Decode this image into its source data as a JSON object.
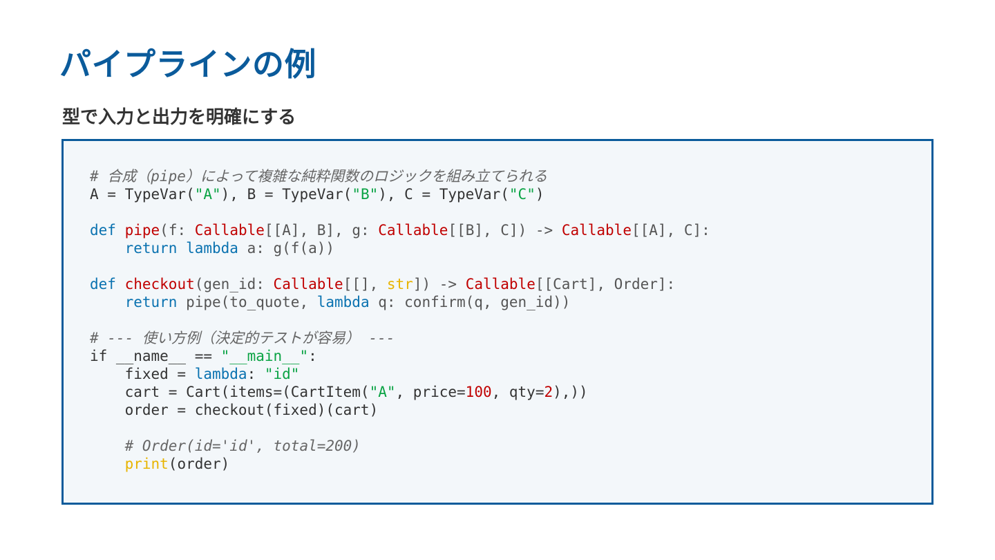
{
  "slide": {
    "title": "パイプラインの例",
    "subtitle": "型で入力と出力を明確にする"
  },
  "code": {
    "lines": [
      [
        {
          "t": "comment",
          "v": "# 合成（pipe）によって複雑な純粋関数のロジックを組み立てられる"
        }
      ],
      [
        {
          "t": "plain",
          "v": "A = TypeVar("
        },
        {
          "t": "str",
          "v": "\"A\""
        },
        {
          "t": "plain",
          "v": "), B = TypeVar("
        },
        {
          "t": "str",
          "v": "\"B\""
        },
        {
          "t": "plain",
          "v": "), C = TypeVar("
        },
        {
          "t": "str",
          "v": "\"C\""
        },
        {
          "t": "plain",
          "v": ")"
        }
      ],
      [],
      [
        {
          "t": "kw",
          "v": "def"
        },
        {
          "t": "plain",
          "v": " "
        },
        {
          "t": "fn",
          "v": "pipe"
        },
        {
          "t": "dim",
          "v": "(f: "
        },
        {
          "t": "type",
          "v": "Callable"
        },
        {
          "t": "dim",
          "v": "[[A], B], g: "
        },
        {
          "t": "type",
          "v": "Callable"
        },
        {
          "t": "dim",
          "v": "[[B], C]) -> "
        },
        {
          "t": "type",
          "v": "Callable"
        },
        {
          "t": "dim",
          "v": "[[A], C]:"
        }
      ],
      [
        {
          "t": "plain",
          "v": "    "
        },
        {
          "t": "kw",
          "v": "return"
        },
        {
          "t": "plain",
          "v": " "
        },
        {
          "t": "kw",
          "v": "lambda"
        },
        {
          "t": "dim",
          "v": " a: g(f(a))"
        }
      ],
      [],
      [
        {
          "t": "kw",
          "v": "def"
        },
        {
          "t": "plain",
          "v": " "
        },
        {
          "t": "fn",
          "v": "checkout"
        },
        {
          "t": "dim",
          "v": "(gen_id: "
        },
        {
          "t": "type",
          "v": "Callable"
        },
        {
          "t": "dim",
          "v": "[[], "
        },
        {
          "t": "builtin",
          "v": "str"
        },
        {
          "t": "dim",
          "v": "]) -> "
        },
        {
          "t": "type",
          "v": "Callable"
        },
        {
          "t": "dim",
          "v": "[[Cart], Order]:"
        }
      ],
      [
        {
          "t": "plain",
          "v": "    "
        },
        {
          "t": "kw",
          "v": "return"
        },
        {
          "t": "dim",
          "v": " pipe(to_quote, "
        },
        {
          "t": "kw",
          "v": "lambda"
        },
        {
          "t": "dim",
          "v": " q: confirm(q, gen_id))"
        }
      ],
      [],
      [
        {
          "t": "comment",
          "v": "# --- 使い方例（決定的テストが容易） ---"
        }
      ],
      [
        {
          "t": "plain",
          "v": "if __name__ == "
        },
        {
          "t": "str",
          "v": "\"__main__\""
        },
        {
          "t": "plain",
          "v": ":"
        }
      ],
      [
        {
          "t": "plain",
          "v": "    fixed = "
        },
        {
          "t": "kw",
          "v": "lambda"
        },
        {
          "t": "plain",
          "v": ": "
        },
        {
          "t": "str",
          "v": "\"id\""
        }
      ],
      [
        {
          "t": "plain",
          "v": "    cart = Cart(items=(CartItem("
        },
        {
          "t": "str",
          "v": "\"A\""
        },
        {
          "t": "plain",
          "v": ", price="
        },
        {
          "t": "num",
          "v": "100"
        },
        {
          "t": "plain",
          "v": ", qty="
        },
        {
          "t": "num",
          "v": "2"
        },
        {
          "t": "plain",
          "v": "),))"
        }
      ],
      [
        {
          "t": "plain",
          "v": "    order = checkout(fixed)(cart)"
        }
      ],
      [],
      [
        {
          "t": "plain",
          "v": "    "
        },
        {
          "t": "comment",
          "v": "# Order(id='id', total=200)"
        }
      ],
      [
        {
          "t": "plain",
          "v": "    "
        },
        {
          "t": "builtin",
          "v": "print"
        },
        {
          "t": "plain",
          "v": "(order)"
        }
      ]
    ]
  }
}
